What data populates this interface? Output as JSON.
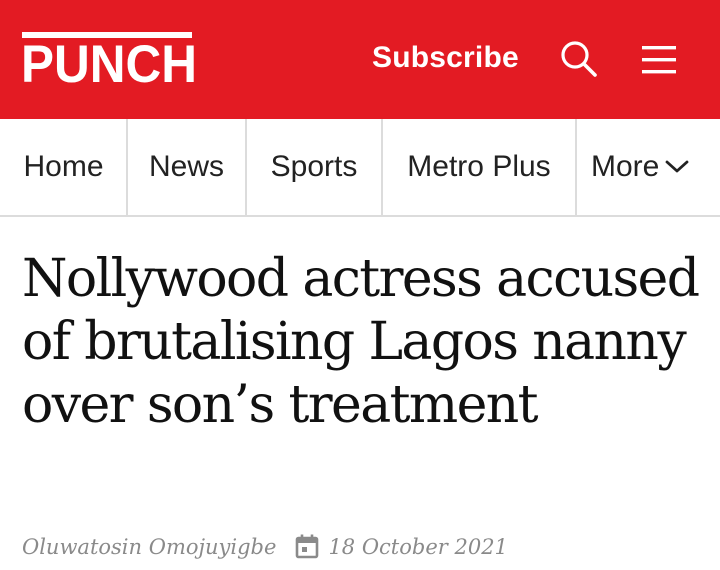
{
  "header": {
    "brand": "PUNCH",
    "subscribe_label": "Subscribe",
    "colors": {
      "brand_red": "#e31b23",
      "text": "#ffffff"
    },
    "icons": [
      "search-icon",
      "hamburger-menu-icon"
    ]
  },
  "nav": {
    "items": [
      {
        "label": "Home"
      },
      {
        "label": "News"
      },
      {
        "label": "Sports"
      },
      {
        "label": "Metro Plus"
      }
    ],
    "more_label": "More"
  },
  "article": {
    "headline": "Nollywood actress accused of brutalising Lagos nanny over son’s treatment",
    "author": "Oluwatosin Omojuyigbe",
    "date": "18 October 2021"
  }
}
